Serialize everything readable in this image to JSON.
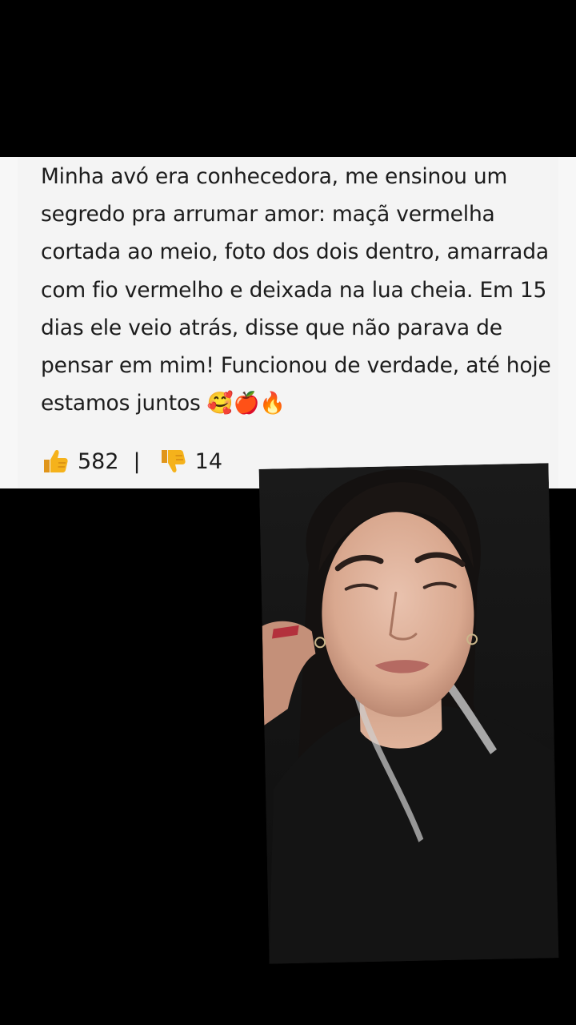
{
  "comment": {
    "text": "Minha avó era conhecedora, me ensinou um segredo pra arrumar amor: maçã vermelha cortada ao meio, foto dos dois dentro, amarrada com fio vermelho e deixada na lua cheia. Em 15 dias ele veio atrás, disse que não parava de pensar em mim! Funcionou de verdade, até hoje estamos juntos 🥰🍎🔥",
    "likes": "582",
    "separator": "|",
    "dislikes": "14",
    "like_icon": "thumbs-up-icon",
    "dislike_icon": "thumbs-down-icon"
  },
  "video": {
    "subject": "woman-speaking-portrait"
  },
  "colors": {
    "background": "#000000",
    "card": "#f4f4f4",
    "text": "#1c1c1c",
    "thumb": "#f5b21b"
  }
}
